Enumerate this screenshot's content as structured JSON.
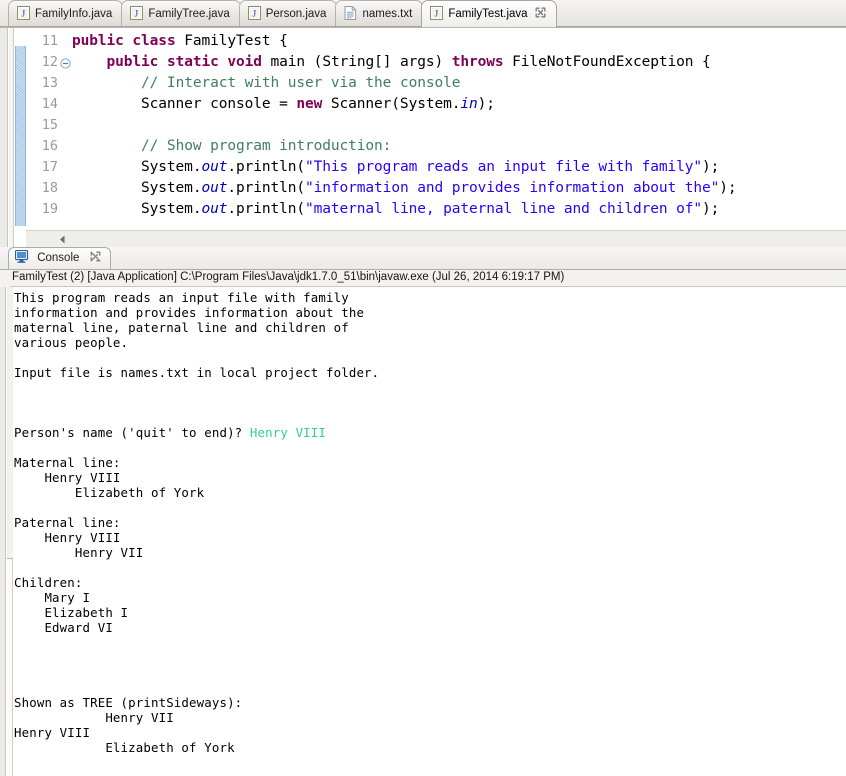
{
  "editor": {
    "tabs": [
      {
        "label": "FamilyInfo.java",
        "icon": "java-file-icon",
        "active": false,
        "closable": false
      },
      {
        "label": "FamilyTree.java",
        "icon": "java-file-icon",
        "active": false,
        "closable": false
      },
      {
        "label": "Person.java",
        "icon": "java-file-icon",
        "active": false,
        "closable": false
      },
      {
        "label": "names.txt",
        "icon": "text-file-icon",
        "active": false,
        "closable": false
      },
      {
        "label": "FamilyTest.java",
        "icon": "java-file-icon",
        "active": true,
        "closable": true
      }
    ],
    "line_numbers": [
      "11",
      "12",
      "13",
      "14",
      "15",
      "16",
      "17",
      "18",
      "19"
    ],
    "fold_marker_line": "12",
    "code_lines": [
      [
        {
          "t": "public",
          "c": "kw"
        },
        {
          "t": " ",
          "c": ""
        },
        {
          "t": "class",
          "c": "kw"
        },
        {
          "t": " FamilyTest {",
          "c": ""
        }
      ],
      [
        {
          "t": "    ",
          "c": ""
        },
        {
          "t": "public",
          "c": "kw"
        },
        {
          "t": " ",
          "c": ""
        },
        {
          "t": "static",
          "c": "kw"
        },
        {
          "t": " ",
          "c": ""
        },
        {
          "t": "void",
          "c": "kw"
        },
        {
          "t": " main (String[] args) ",
          "c": ""
        },
        {
          "t": "throws",
          "c": "kw"
        },
        {
          "t": " FileNotFoundException {",
          "c": ""
        }
      ],
      [
        {
          "t": "        ",
          "c": ""
        },
        {
          "t": "// Interact with user via the console",
          "c": "cm"
        }
      ],
      [
        {
          "t": "        Scanner console = ",
          "c": ""
        },
        {
          "t": "new",
          "c": "kw"
        },
        {
          "t": " Scanner(System.",
          "c": ""
        },
        {
          "t": "in",
          "c": "fld"
        },
        {
          "t": ");",
          "c": ""
        }
      ],
      [
        {
          "t": "",
          "c": ""
        }
      ],
      [
        {
          "t": "        ",
          "c": ""
        },
        {
          "t": "// Show program introduction:",
          "c": "cm"
        }
      ],
      [
        {
          "t": "        System.",
          "c": ""
        },
        {
          "t": "out",
          "c": "fld"
        },
        {
          "t": ".println(",
          "c": ""
        },
        {
          "t": "\"This program reads an input file with family\"",
          "c": "st"
        },
        {
          "t": ");",
          "c": ""
        }
      ],
      [
        {
          "t": "        System.",
          "c": ""
        },
        {
          "t": "out",
          "c": "fld"
        },
        {
          "t": ".println(",
          "c": ""
        },
        {
          "t": "\"information and provides information about the\"",
          "c": "st"
        },
        {
          "t": ");",
          "c": ""
        }
      ],
      [
        {
          "t": "        System.",
          "c": ""
        },
        {
          "t": "out",
          "c": "fld"
        },
        {
          "t": ".println(",
          "c": ""
        },
        {
          "t": "\"maternal line, paternal line and children of\"",
          "c": "st"
        },
        {
          "t": ");",
          "c": ""
        }
      ]
    ]
  },
  "console": {
    "tab_label": "Console",
    "tab_icon": "console-monitor-icon",
    "close_icon": "close-icon",
    "launch_title": "FamilyTest (2) [Java Application] C:\\Program Files\\Java\\jdk1.7.0_51\\bin\\javaw.exe (Jul 26, 2014 6:19:17 PM)",
    "user_input_color": "#2fcf99",
    "output_lines": [
      {
        "text": "This program reads an input file with family"
      },
      {
        "text": "information and provides information about the"
      },
      {
        "text": "maternal line, paternal line and children of"
      },
      {
        "text": "various people."
      },
      {
        "text": ""
      },
      {
        "text": "Input file is names.txt in local project folder."
      },
      {
        "text": ""
      },
      {
        "text": ""
      },
      {
        "text": ""
      },
      {
        "text": "Person's name ('quit' to end)? ",
        "input": "Henry VIII"
      },
      {
        "text": ""
      },
      {
        "text": "Maternal line:"
      },
      {
        "text": "    Henry VIII"
      },
      {
        "text": "        Elizabeth of York"
      },
      {
        "text": ""
      },
      {
        "text": "Paternal line:"
      },
      {
        "text": "    Henry VIII"
      },
      {
        "text": "        Henry VII"
      },
      {
        "text": ""
      },
      {
        "text": "Children:"
      },
      {
        "text": "    Mary I"
      },
      {
        "text": "    Elizabeth I"
      },
      {
        "text": "    Edward VI"
      },
      {
        "text": ""
      },
      {
        "text": ""
      },
      {
        "text": ""
      },
      {
        "text": ""
      },
      {
        "text": "Shown as TREE (printSideways):"
      },
      {
        "text": "            Henry VII"
      },
      {
        "text": "Henry VIII"
      },
      {
        "text": "            Elizabeth of York"
      }
    ]
  }
}
